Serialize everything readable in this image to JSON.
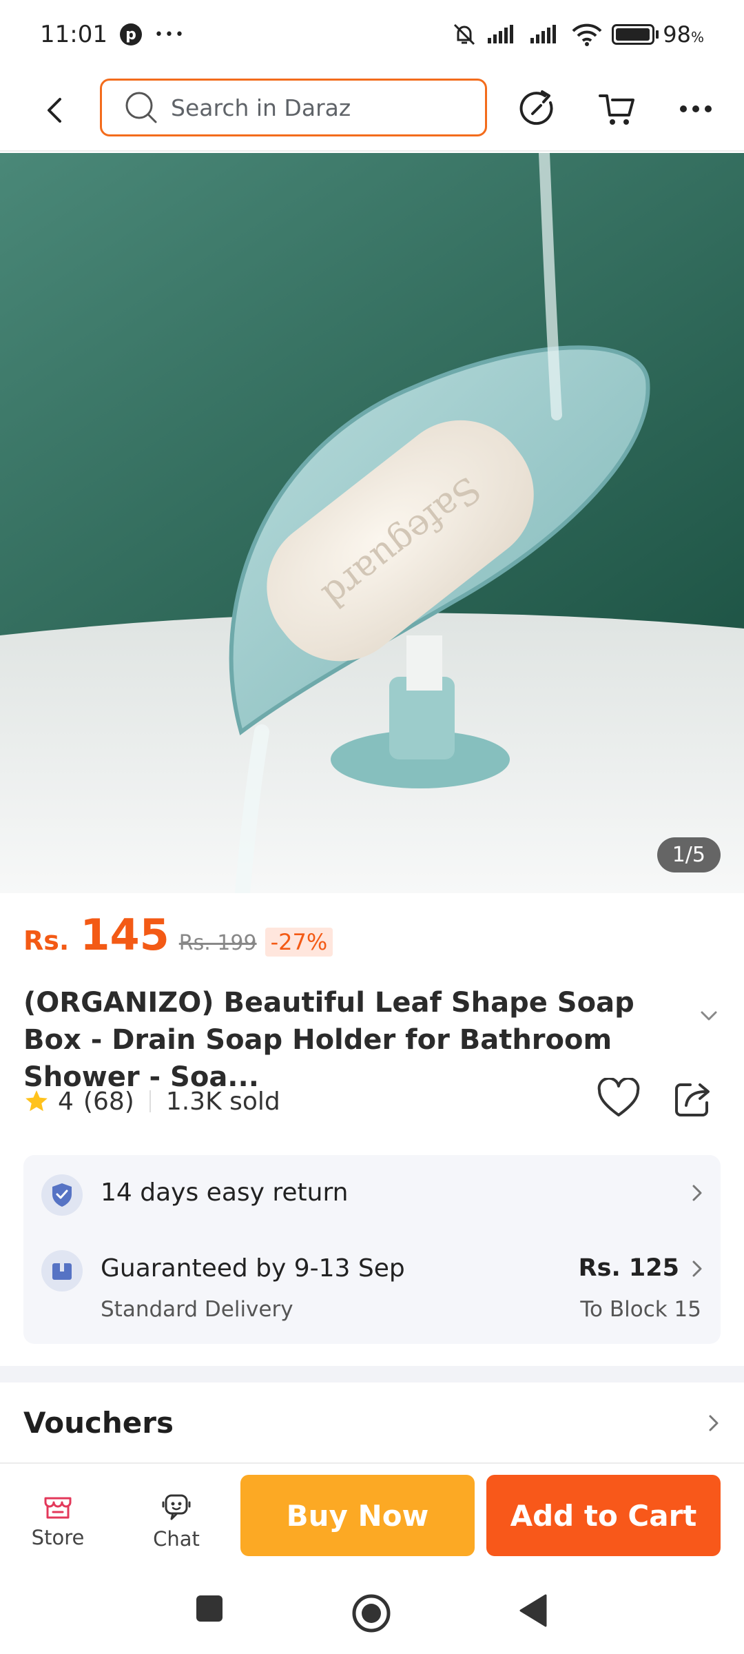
{
  "status_bar": {
    "time": "11:01",
    "more_glyph": "•••",
    "pin_glyph": "p",
    "battery_percent": "98",
    "battery_level": 0.98,
    "battery_unit": "%",
    "icons": [
      "pinterest-icon",
      "bell-off-icon",
      "signal-icon",
      "signal-icon",
      "wifi-icon",
      "battery-icon"
    ]
  },
  "nav": {
    "search_placeholder": "Search in Daraz",
    "icons": [
      "back-icon",
      "search-icon",
      "share-refresh-icon",
      "cart-icon",
      "more-icon"
    ]
  },
  "gallery": {
    "indicator": "1/5"
  },
  "price": {
    "currency": "Rs.",
    "current": "145",
    "original": "Rs. 199",
    "discount": "-27%",
    "accent_color": "#f35a15"
  },
  "product": {
    "title": "(ORGANIZO) Beautiful Leaf Shape Soap Box - Drain Soap Holder for Bathroom Shower - Soa...",
    "rating": "4",
    "reviews": "(68)",
    "sold": "1.3K sold"
  },
  "services": {
    "return_text": "14 days easy return",
    "delivery_title": "Guaranteed by 9-13 Sep",
    "delivery_sub": "Standard Delivery",
    "delivery_price": "Rs. 125",
    "delivery_dest": "To Block 15"
  },
  "vouchers": {
    "label": "Vouchers"
  },
  "bottom_bar": {
    "store_label": "Store",
    "chat_label": "Chat",
    "buy_now": "Buy Now",
    "add_to_cart": "Add to Cart",
    "buy_color": "#fca924",
    "cart_color": "#f8581a"
  }
}
